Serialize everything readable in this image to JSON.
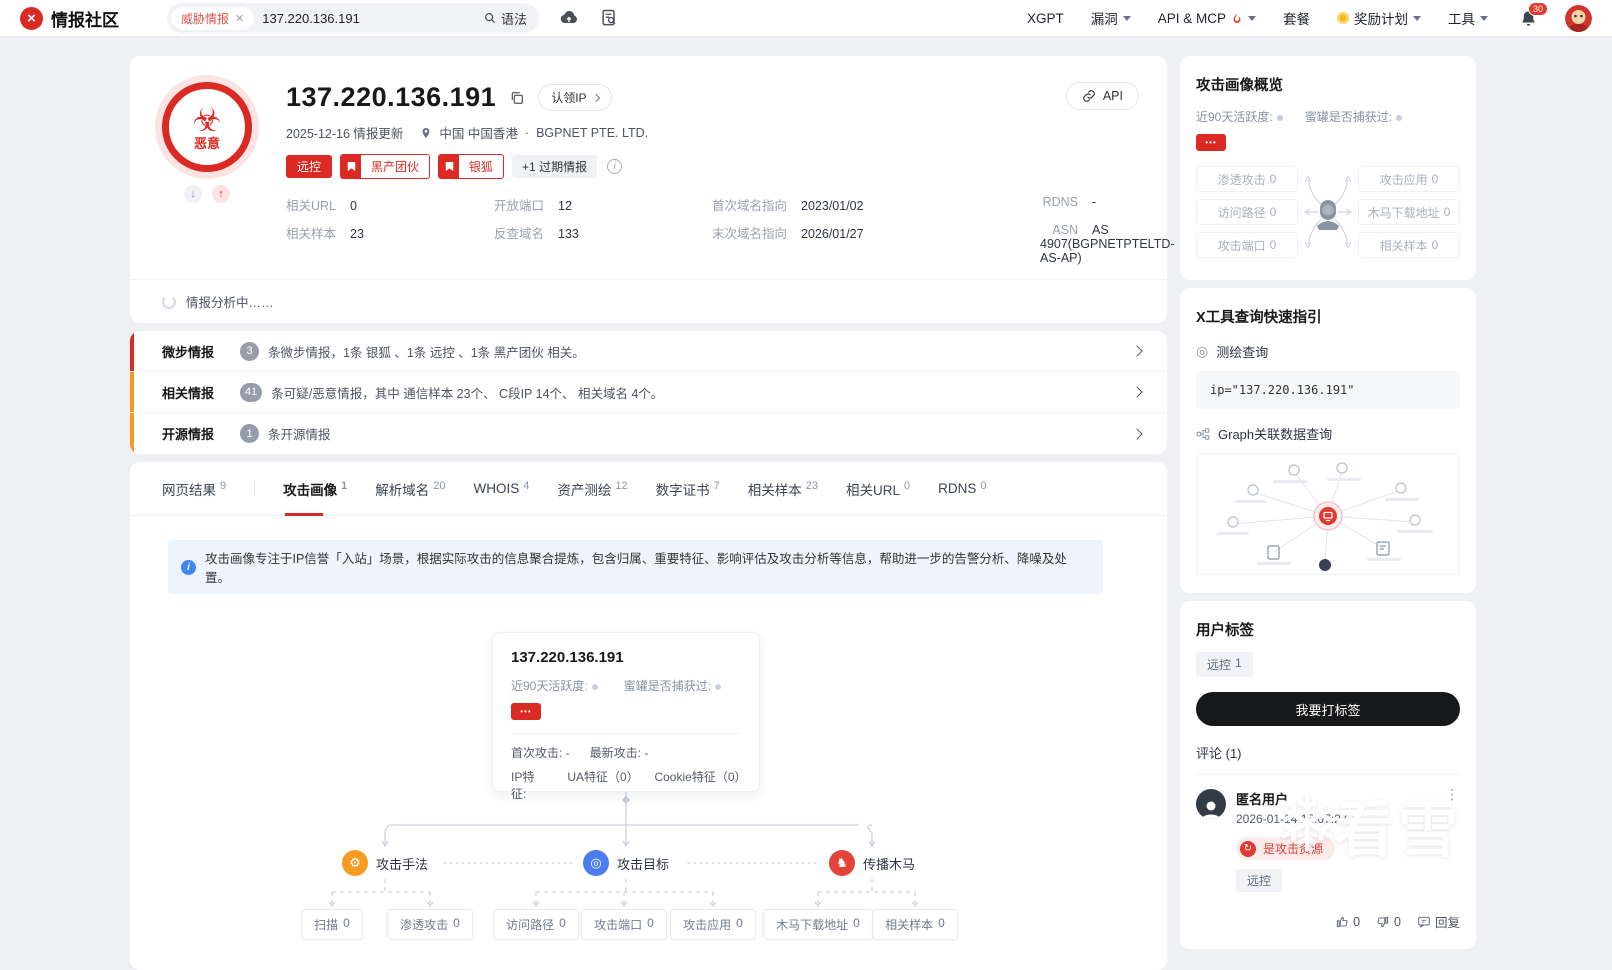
{
  "colors": {
    "accent": "#da2a23",
    "orange": "#f59b22",
    "blue": "#4086f4",
    "banner_bg": "#eef4fe",
    "black_button": "#17181a"
  },
  "nav": {
    "brand": "情报社区",
    "search_tab": "威胁情报",
    "search_value": "137.220.136.191",
    "syntax_label": "语法",
    "menu": [
      {
        "label": "XGPT"
      },
      {
        "label": "漏洞"
      },
      {
        "label": "API & MCP"
      },
      {
        "label": "套餐"
      },
      {
        "label": "奖励计划"
      },
      {
        "label": "工具"
      }
    ],
    "notification_count": "30"
  },
  "header": {
    "ip": "137.220.136.191",
    "verdict": "恶意",
    "claim_button": "认领IP",
    "api_button": "API",
    "updated": "2025-12-16 情报更新",
    "location": "中国 中国香港",
    "separator": "·",
    "isp": "BGPNET PTE. LTD.",
    "tags": [
      {
        "label": "远控"
      },
      {
        "label": "黑产团伙"
      },
      {
        "label": "银狐"
      },
      {
        "label": "+1 过期情报"
      }
    ],
    "stats": [
      {
        "label": "相关URL",
        "value": "0"
      },
      {
        "label": "开放端口",
        "value": "12"
      },
      {
        "label": "首次域名指向",
        "value": "2023/01/02"
      },
      {
        "label": "RDNS",
        "value": "-"
      },
      {
        "label": "相关样本",
        "value": "23"
      },
      {
        "label": "反查域名",
        "value": "133"
      },
      {
        "label": "末次域名指向",
        "value": "2026/01/27"
      },
      {
        "label": "ASN",
        "value": "AS 4907(BGPNETPTELTD-AS-AP)"
      }
    ],
    "analyzing": "情报分析中……"
  },
  "intel": {
    "rows": [
      {
        "title": "微步情报",
        "count": "3",
        "desc": "条微步情报，1条 银狐 、1条 远控 、1条 黑产团伙 相关。"
      },
      {
        "title": "相关情报",
        "count": "41",
        "desc": "条可疑/恶意情报，其中 通信样本 23个、 C段IP 14个、 相关域名 4个。"
      },
      {
        "title": "开源情报",
        "count": "1",
        "desc": "条开源情报"
      }
    ]
  },
  "tabs": {
    "items": [
      {
        "label": "网页结果",
        "count": "9"
      },
      {
        "label": "攻击画像",
        "count": "1"
      },
      {
        "label": "解析域名",
        "count": "20"
      },
      {
        "label": "WHOIS",
        "count": "4"
      },
      {
        "label": "资产测绘",
        "count": "12"
      },
      {
        "label": "数字证书",
        "count": "7"
      },
      {
        "label": "相关样本",
        "count": "23"
      },
      {
        "label": "相关URL",
        "count": "0"
      },
      {
        "label": "RDNS",
        "count": "0"
      }
    ]
  },
  "banner": {
    "text": "攻击画像专注于IP信誉「入站」场景，根据实际攻击的信息聚合提炼，包含归属、重要特征、影响评估及攻击分析等信息，帮助进一步的告警分析、降噪及处置。"
  },
  "profile": {
    "ip": "137.220.136.191",
    "activity_label": "近90天活跃度:",
    "honeypot_label": "蜜罐是否捕获过:",
    "badge": "•••",
    "first_attack": "首次攻击: -",
    "latest_attack": "最新攻击: -",
    "features_label": "IP特征:",
    "ua_feature": "UA特征（0）",
    "cookie_feature": "Cookie特征（0）"
  },
  "tree": {
    "nodes": [
      {
        "label": "攻击手法",
        "children": [
          {
            "label": "扫描",
            "count": "0"
          },
          {
            "label": "渗透攻击",
            "count": "0"
          }
        ]
      },
      {
        "label": "攻击目标",
        "children": [
          {
            "label": "访问路径",
            "count": "0"
          },
          {
            "label": "攻击端口",
            "count": "0"
          },
          {
            "label": "攻击应用",
            "count": "0"
          }
        ]
      },
      {
        "label": "传播木马",
        "children": [
          {
            "label": "木马下载地址",
            "count": "0"
          },
          {
            "label": "相关样本",
            "count": "0"
          }
        ]
      }
    ]
  },
  "sidebar": {
    "overview": {
      "title": "攻击画像概览",
      "activity_label": "近90天活跃度:",
      "honeypot_label": "蜜罐是否捕获过:",
      "badge": "•••",
      "left_boxes": [
        {
          "label": "渗透攻击",
          "count": "0"
        },
        {
          "label": "访问路径",
          "count": "0"
        },
        {
          "label": "攻击端口",
          "count": "0"
        }
      ],
      "right_boxes": [
        {
          "label": "攻击应用",
          "count": "0"
        },
        {
          "label": "木马下载地址",
          "count": "0"
        },
        {
          "label": "相关样本",
          "count": "0"
        }
      ]
    },
    "xtools": {
      "title": "X工具查询快速指引",
      "mapping_label": "测绘查询",
      "query": "ip=\"137.220.136.191\"",
      "graph_label": "Graph关联数据查询"
    },
    "user_tags": {
      "title": "用户标签",
      "tag": "远控",
      "tag_count": "1",
      "button": "我要打标签"
    },
    "comments": {
      "title": "评论 (1)",
      "items": [
        {
          "user": "匿名用户",
          "time": "2026-01-14 15:07:27",
          "badge": "是攻击资源",
          "tag": "远控",
          "like_count": "0",
          "dislike_count": "0",
          "reply_label": "回复"
        }
      ]
    }
  },
  "watermark": {
    "text": "看雪"
  }
}
